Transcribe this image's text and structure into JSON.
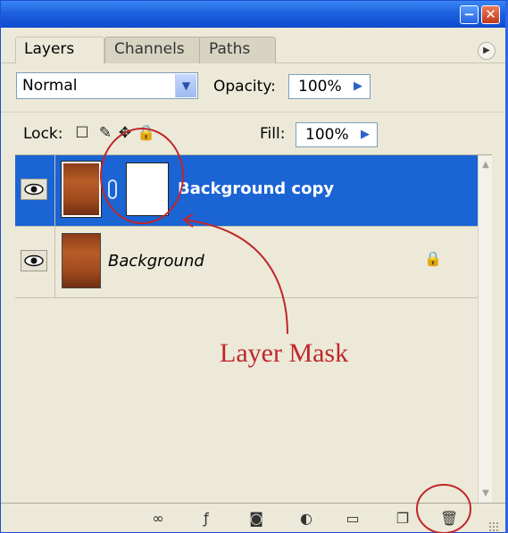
{
  "window": {
    "minimize_glyph": "−",
    "close_glyph": "✕"
  },
  "tabs": [
    {
      "label": "Layers",
      "active": true
    },
    {
      "label": "Channels",
      "active": false
    },
    {
      "label": "Paths",
      "active": false
    }
  ],
  "palette_menu_glyph": "▶",
  "blend": {
    "value": "Normal",
    "arrow_glyph": "▼"
  },
  "opacity": {
    "label": "Opacity:",
    "value": "100%",
    "arrow_glyph": "▶"
  },
  "lock": {
    "label": "Lock:",
    "icons": [
      "lock-transparency-icon",
      "lock-image-icon",
      "lock-position-icon",
      "lock-all-icon"
    ],
    "glyphs": [
      "☐",
      "✎",
      "✥",
      "🔒"
    ]
  },
  "fill": {
    "label": "Fill:",
    "value": "100%",
    "arrow_glyph": "▶"
  },
  "layers": [
    {
      "name": "Background copy",
      "visible": true,
      "selected": true,
      "has_mask": true
    },
    {
      "name": "Background",
      "visible": true,
      "selected": false,
      "locked": true,
      "lock_glyph": "🔒"
    }
  ],
  "bottom_icons": [
    {
      "name": "link-layers-icon",
      "glyph": "∞"
    },
    {
      "name": "layer-style-icon",
      "glyph": "ƒ"
    },
    {
      "name": "add-mask-icon",
      "glyph": "◙"
    },
    {
      "name": "adjustment-layer-icon",
      "glyph": "◐"
    },
    {
      "name": "new-group-icon",
      "glyph": "▭"
    },
    {
      "name": "new-layer-icon",
      "glyph": "❐"
    },
    {
      "name": "delete-layer-icon",
      "glyph": "🗑"
    }
  ],
  "annotation": {
    "text": "Layer Mask",
    "color": "#c0262a"
  },
  "colors": {
    "selection": "#1a64d4",
    "titlebar": "#1e61e0",
    "panel": "#ece9d8",
    "annotation": "#c0262a"
  }
}
